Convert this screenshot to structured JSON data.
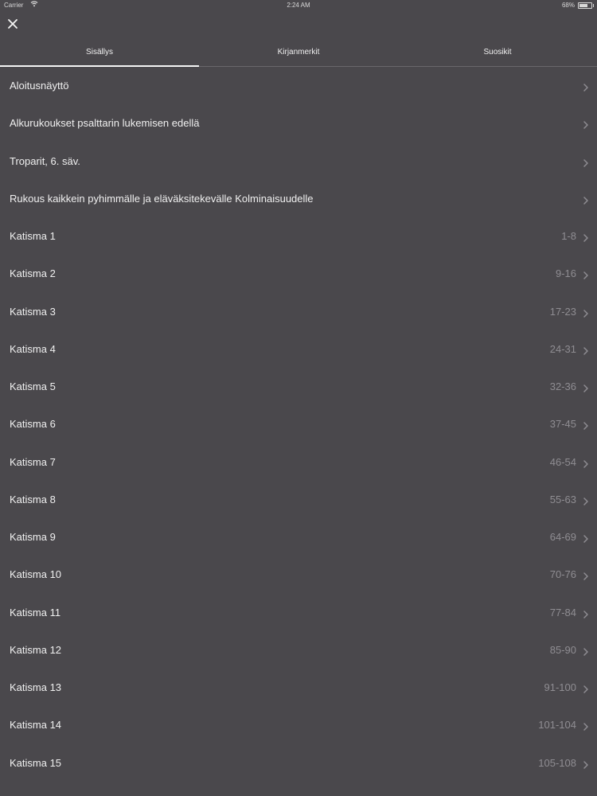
{
  "status_bar": {
    "carrier": "Carrier",
    "time": "2:24 AM",
    "battery_percent": "68%",
    "battery_level": 0.68
  },
  "close_icon": "close-icon",
  "tabs": [
    {
      "label": "Sisällys",
      "active": true
    },
    {
      "label": "Kirjanmerkit",
      "active": false
    },
    {
      "label": "Suosikit",
      "active": false
    }
  ],
  "items": [
    {
      "label": "Aloitusnäyttö",
      "range": ""
    },
    {
      "label": "Alkurukoukset psalttarin lukemisen edellä",
      "range": ""
    },
    {
      "label": "Troparit, 6. säv.",
      "range": ""
    },
    {
      "label": "Rukous kaikkein pyhimmälle ja eläväksitekevälle Kolminaisuudelle",
      "range": ""
    },
    {
      "label": "Katisma 1",
      "range": "1-8"
    },
    {
      "label": "Katisma 2",
      "range": "9-16"
    },
    {
      "label": "Katisma 3",
      "range": "17-23"
    },
    {
      "label": "Katisma 4",
      "range": "24-31"
    },
    {
      "label": "Katisma 5",
      "range": "32-36"
    },
    {
      "label": "Katisma 6",
      "range": "37-45"
    },
    {
      "label": "Katisma 7",
      "range": "46-54"
    },
    {
      "label": "Katisma 8",
      "range": "55-63"
    },
    {
      "label": "Katisma 9",
      "range": "64-69"
    },
    {
      "label": "Katisma 10",
      "range": "70-76"
    },
    {
      "label": "Katisma 11",
      "range": "77-84"
    },
    {
      "label": "Katisma 12",
      "range": "85-90"
    },
    {
      "label": "Katisma 13",
      "range": "91-100"
    },
    {
      "label": "Katisma 14",
      "range": "101-104"
    },
    {
      "label": "Katisma 15",
      "range": "105-108"
    }
  ],
  "colors": {
    "background": "#4a484c",
    "text": "#f0f0f0",
    "secondary_text": "#8f8d92"
  }
}
